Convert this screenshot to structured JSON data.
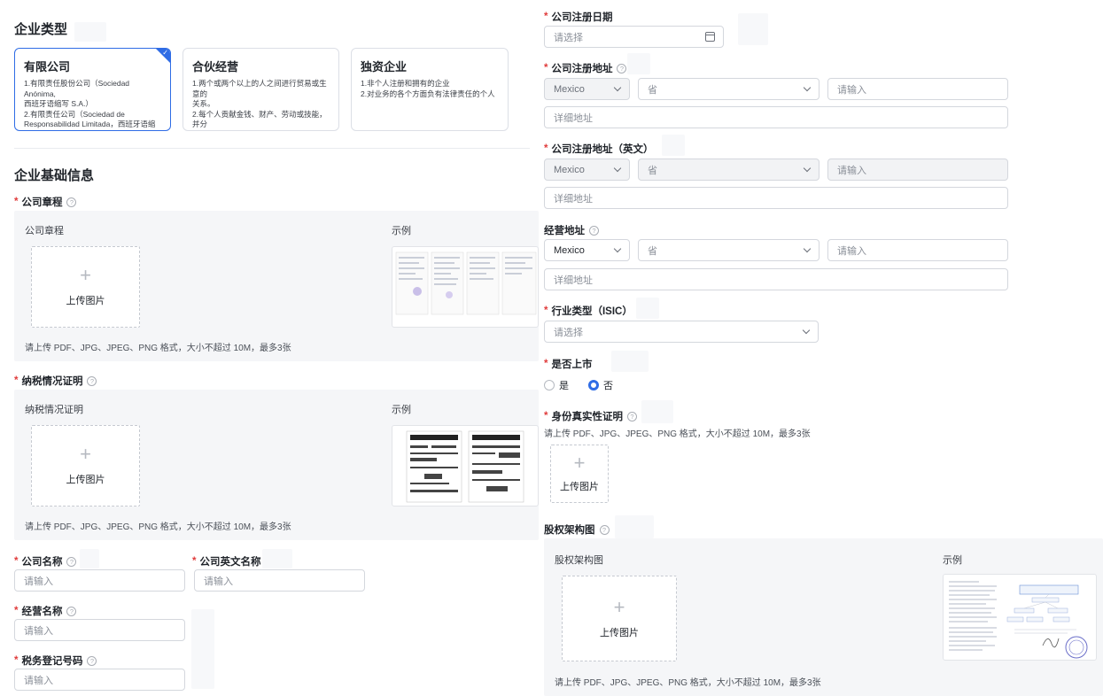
{
  "enterprise_type": {
    "title": "企业类型",
    "options": [
      {
        "label": "有限公司",
        "desc": "1.有限责任股份公司（Sociedad Anónima,\n西班牙语缩写 S.A.）\n2.有限责任公司（Sociedad de\nResponsabilidad Limitada，西班牙语缩写为\nS. de R.L.）",
        "selected": true
      },
      {
        "label": "合伙经营",
        "desc": "1.两个或两个以上的人之间进行贸易或生意的\n关系。\n2.每个人贡献金钱、财产、劳动或技能，并分\n享业务的利润和损失。",
        "selected": false
      },
      {
        "label": "独资企业",
        "desc": "1.非个人注册和拥有的企业\n2.对业务的各个方面负有法律责任的个人",
        "selected": false
      }
    ]
  },
  "basic_info": {
    "title": "企业基础信息",
    "articles": {
      "label": "公司章程",
      "panel_label": "公司章程",
      "sample_label": "示例",
      "upload_text": "上传图片",
      "hint": "请上传 PDF、JPG、JPEG、PNG 格式，大小不超过 10M，最多3张"
    },
    "tax_cert": {
      "label": "纳税情况证明",
      "panel_label": "纳税情况证明",
      "sample_label": "示例",
      "upload_text": "上传图片",
      "hint": "请上传 PDF、JPG、JPEG、PNG 格式，大小不超过 10M，最多3张"
    },
    "company_name": {
      "label": "公司名称",
      "placeholder": "请输入"
    },
    "company_name_en": {
      "label": "公司英文名称",
      "placeholder": "请输入"
    },
    "business_name": {
      "label": "经营名称",
      "placeholder": "请输入"
    },
    "tax_id": {
      "label": "税务登记号码",
      "placeholder": "请输入"
    }
  },
  "right": {
    "reg_date": {
      "label": "公司注册日期",
      "placeholder": "请选择"
    },
    "reg_address": {
      "label": "公司注册地址",
      "country": "Mexico",
      "province": "省",
      "city_placeholder": "请输入",
      "detail_placeholder": "详细地址"
    },
    "reg_address_en": {
      "label": "公司注册地址（英文）",
      "country": "Mexico",
      "province": "省",
      "city_placeholder": "请输入",
      "detail_placeholder": "详细地址"
    },
    "biz_address": {
      "label": "经营地址",
      "country": "Mexico",
      "province": "省",
      "city_placeholder": "请输入",
      "detail_placeholder": "详细地址"
    },
    "industry": {
      "label": "行业类型（ISIC）",
      "placeholder": "请选择"
    },
    "listed": {
      "label": "是否上市",
      "options": [
        "是",
        "否"
      ],
      "selected": "否"
    },
    "identity": {
      "label": "身份真实性证明",
      "hint": "请上传 PDF、JPG、JPEG、PNG 格式，大小不超过 10M，最多3张",
      "upload_text": "上传图片"
    },
    "equity": {
      "label": "股权架构图",
      "panel_label": "股权架构图",
      "sample_label": "示例",
      "upload_text": "上传图片",
      "hint": "请上传 PDF、JPG、JPEG、PNG 格式，大小不超过 10M，最多3张"
    }
  },
  "icons": {
    "help": "help-circle-icon",
    "chevron": "chevron-down-icon",
    "calendar": "calendar-icon",
    "plus": "plus-icon"
  },
  "colors": {
    "accent": "#2f6ce5",
    "required": "#e03b3b",
    "panel_bg": "#f5f6f8"
  }
}
